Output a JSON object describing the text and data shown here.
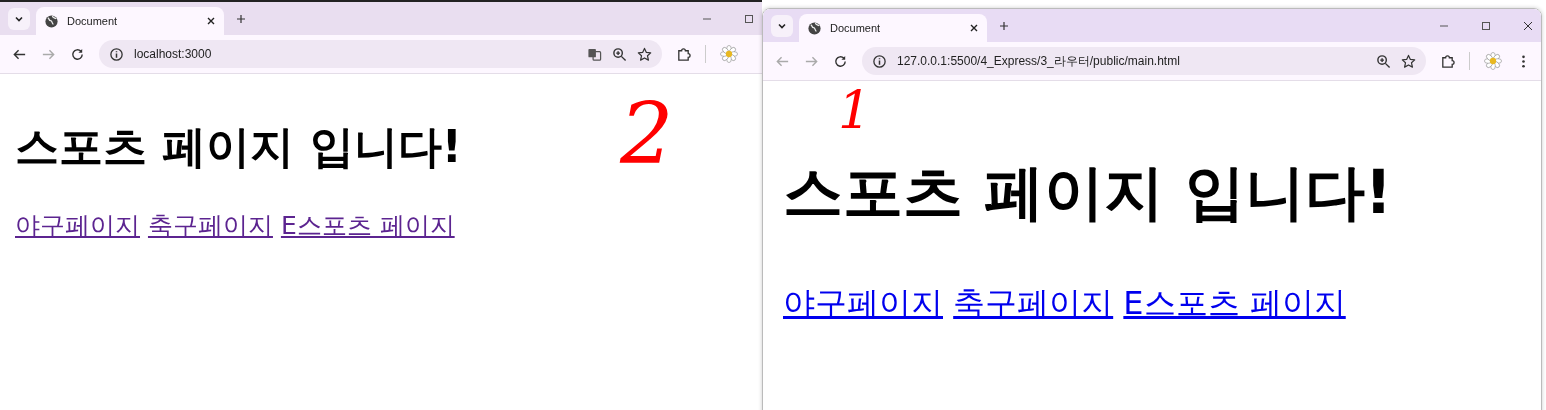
{
  "windows": [
    {
      "tab": {
        "title": "Document"
      },
      "address": "localhost:3000",
      "address_icons": [
        {
          "kind": "translate"
        },
        {
          "kind": "zoom"
        },
        {
          "kind": "bookmark"
        }
      ],
      "heading": "스포츠 페이지 입니다!",
      "links": [
        {
          "label": "야구페이지",
          "visited": true
        },
        {
          "label": "축구페이지",
          "visited": true
        },
        {
          "label": "E스포츠 페이지",
          "visited": true
        }
      ]
    },
    {
      "tab": {
        "title": "Document"
      },
      "address": "127.0.0.1:5500/4_Express/3_라우터/public/main.html",
      "address_icons": [
        {
          "kind": "zoom"
        },
        {
          "kind": "bookmark"
        }
      ],
      "heading": "스포츠 페이지 입니다!",
      "links": [
        {
          "label": "야구페이지",
          "visited": false
        },
        {
          "label": "축구페이지",
          "visited": false
        },
        {
          "label": "E스포츠 페이지",
          "visited": false
        }
      ]
    }
  ],
  "annotations": [
    {
      "text": "2"
    },
    {
      "text": "1"
    }
  ]
}
